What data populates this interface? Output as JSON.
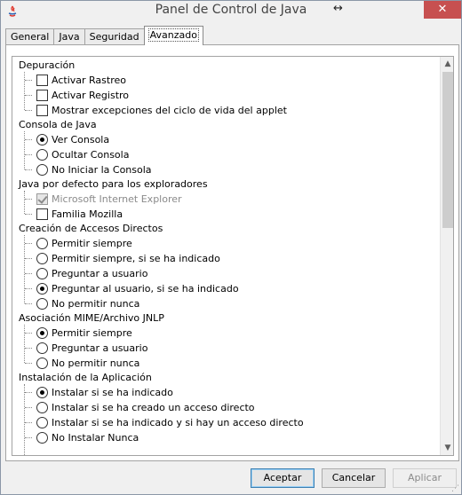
{
  "window": {
    "title": "Panel de Control de Java",
    "close_glyph": "✕",
    "resize_glyph": "↔"
  },
  "tabs": [
    {
      "label": "General"
    },
    {
      "label": "Java"
    },
    {
      "label": "Seguridad"
    },
    {
      "label": "Avanzado",
      "active": true
    }
  ],
  "settings": {
    "depuracion": {
      "title": "Depuración",
      "options": [
        {
          "label": "Activar Rastreo",
          "checked": false
        },
        {
          "label": "Activar Registro",
          "checked": false
        },
        {
          "label": "Mostrar excepciones del ciclo de vida del applet",
          "checked": false
        }
      ]
    },
    "consola": {
      "title": "Consola de Java",
      "options": [
        {
          "label": "Ver Consola",
          "selected": true
        },
        {
          "label": "Ocultar Consola",
          "selected": false
        },
        {
          "label": "No Iniciar la Consola",
          "selected": false
        }
      ]
    },
    "exploradores": {
      "title": "Java por defecto para los exploradores",
      "options": [
        {
          "label": "Microsoft Internet Explorer",
          "checked": true,
          "disabled": true
        },
        {
          "label": "Familia Mozilla",
          "checked": false
        }
      ]
    },
    "accesos": {
      "title": "Creación de Accesos Directos",
      "options": [
        {
          "label": "Permitir siempre",
          "selected": false
        },
        {
          "label": "Permitir siempre, si se ha indicado",
          "selected": false
        },
        {
          "label": "Preguntar a usuario",
          "selected": false
        },
        {
          "label": "Preguntar al usuario, si se ha indicado",
          "selected": true
        },
        {
          "label": "No permitir nunca",
          "selected": false
        }
      ]
    },
    "mime": {
      "title": "Asociación MIME/Archivo JNLP",
      "options": [
        {
          "label": "Permitir siempre",
          "selected": true
        },
        {
          "label": "Preguntar a usuario",
          "selected": false
        },
        {
          "label": "No permitir nunca",
          "selected": false
        }
      ]
    },
    "instalacion": {
      "title": "Instalación de la Aplicación",
      "options": [
        {
          "label": "Instalar si se ha indicado",
          "selected": true
        },
        {
          "label": "Instalar si se ha creado un acceso directo",
          "selected": false
        },
        {
          "label": "Instalar si se ha indicado y si hay un acceso directo",
          "selected": false
        },
        {
          "label": "No Instalar Nunca",
          "selected": false
        }
      ]
    }
  },
  "buttons": {
    "accept": "Aceptar",
    "cancel": "Cancelar",
    "apply": "Aplicar"
  },
  "scrollbar": {
    "up_glyph": "▲",
    "down_glyph": "▼"
  }
}
